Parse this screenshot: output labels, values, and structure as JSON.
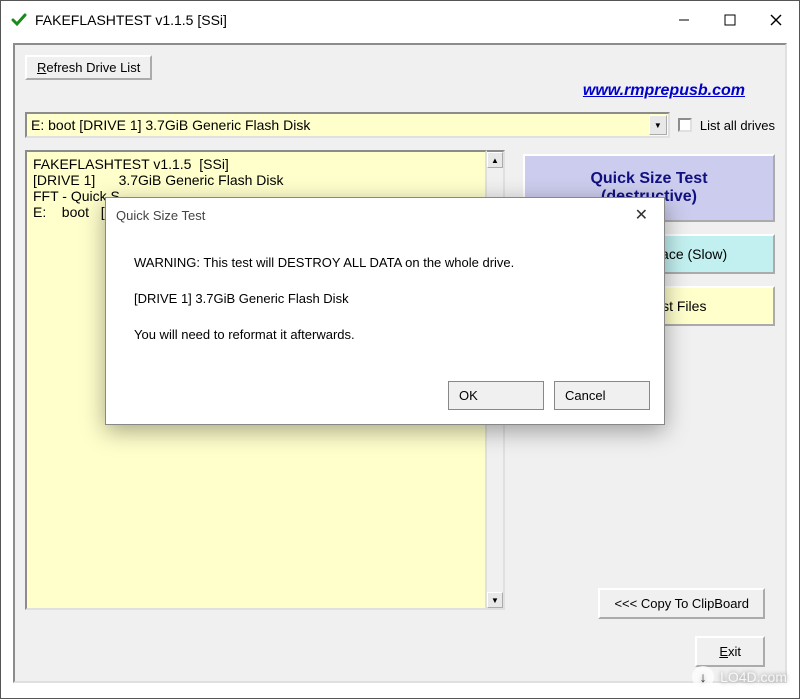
{
  "window": {
    "title": "FAKEFLASHTEST v1.1.5  [SSi]",
    "icon": "check-icon"
  },
  "top": {
    "refresh_label_pre": "R",
    "refresh_label_post": "efresh Drive List",
    "url": "www.rmprepusb.com"
  },
  "drive": {
    "selected": "E:    boot   [DRIVE 1]      3.7GiB Generic Flash Disk",
    "list_all_label": "List all drives"
  },
  "log": {
    "lines": "FAKEFLASHTEST v1.1.5  [SSi]\n[DRIVE 1]      3.7GiB Generic Flash Disk\nFFT - Quick S\nE:    boot   [D"
  },
  "side": {
    "quick_test_line1": "Quick Size Test",
    "quick_test_line2": "(destructive)",
    "empty_space": "Test Empty Space (Slow)",
    "remove_files": "Remove Test Files"
  },
  "bottom": {
    "copy_clip": "<<< Copy To ClipBoard",
    "exit_pre": "E",
    "exit_post": "xit"
  },
  "modal": {
    "title": "Quick Size Test",
    "warning": "WARNING: This test will DESTROY ALL DATA on the whole drive.",
    "drive_info": "[DRIVE 1]        3.7GiB Generic Flash Disk",
    "reformat": "You will need to reformat it afterwards.",
    "ok": "OK",
    "cancel": "Cancel"
  },
  "watermark": {
    "text": "LO4D.com"
  }
}
